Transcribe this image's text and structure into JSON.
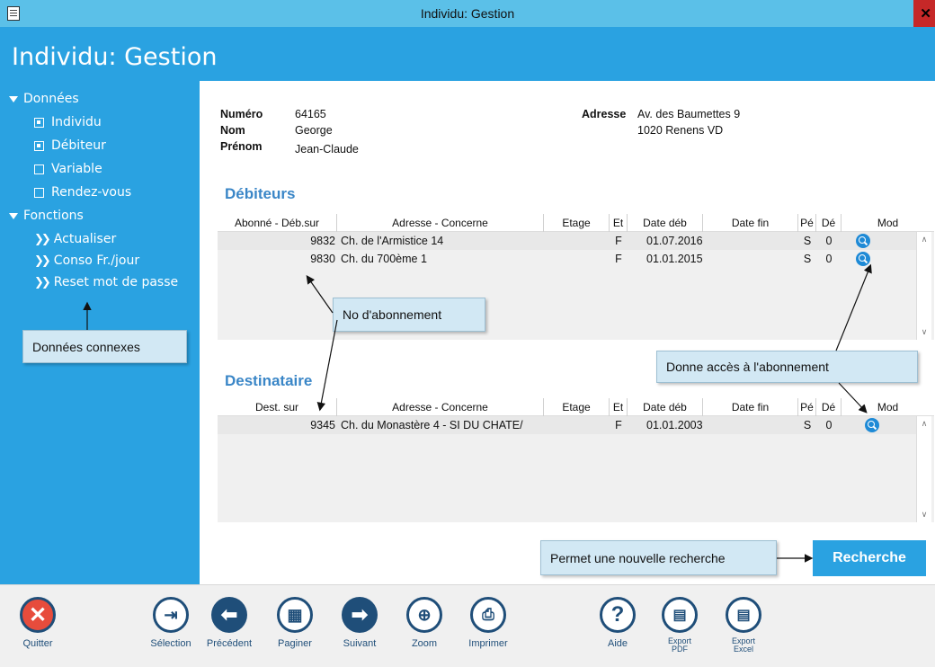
{
  "window": {
    "title": "Individu: Gestion"
  },
  "header": {
    "title": "Individu: Gestion"
  },
  "sidebar": {
    "groups": [
      {
        "label": "Données",
        "items": [
          "Individu",
          "Débiteur",
          "Variable",
          "Rendez-vous"
        ]
      },
      {
        "label": "Fonctions",
        "items": [
          "Actualiser",
          "Conso Fr./jour",
          "Reset mot de passe"
        ]
      }
    ]
  },
  "person": {
    "numero_label": "Numéro",
    "numero": "64165",
    "nom_label": "Nom",
    "nom": "George",
    "prenom_label": "Prénom",
    "prenom": "Jean-Claude",
    "adresse_label": "Adresse",
    "adresse_line1": "Av. des Baumettes 9",
    "adresse_line2": "1020 Renens VD"
  },
  "debiteurs": {
    "title": "Débiteurs",
    "columns": [
      "Abonné - Déb.sur",
      "Adresse - Concerne",
      "Etage",
      "Et",
      "Date déb",
      "Date fin",
      "Pé",
      "Dé",
      "Mod"
    ],
    "rows": [
      {
        "num": "9832",
        "adresse": "Ch. de l'Armistice 14",
        "etage": "",
        "et": "F",
        "date_deb": "01.07.2016",
        "date_fin": "",
        "pe": "S",
        "de": "0"
      },
      {
        "num": "9830",
        "adresse": "Ch. du 700ème 1",
        "etage": "",
        "et": "F",
        "date_deb": "01.01.2015",
        "date_fin": "",
        "pe": "S",
        "de": "0"
      }
    ]
  },
  "destinataire": {
    "title": "Destinataire",
    "columns": [
      "Dest. sur",
      "Adresse - Concerne",
      "Etage",
      "Et",
      "Date déb",
      "Date fin",
      "Pé",
      "Dé",
      "Mod"
    ],
    "rows": [
      {
        "num": "9345",
        "adresse": "Ch. du Monastère 4 - SI DU CHATE/",
        "etage": "",
        "et": "F",
        "date_deb": "01.01.2003",
        "date_fin": "",
        "pe": "S",
        "de": "0"
      }
    ]
  },
  "callouts": {
    "donnees_connexes": "Données connexes",
    "no_abonnement": "No d'abonnement",
    "acces_abonnement": "Donne accès à l'abonnement",
    "nouvelle_recherche": "Permet une nouvelle recherche"
  },
  "search_button": "Recherche",
  "toolbar": {
    "quitter": "Quitter",
    "selection": "Sélection",
    "precedent": "Précédent",
    "paginer": "Paginer",
    "suivant": "Suivant",
    "zoom": "Zoom",
    "imprimer": "Imprimer",
    "aide": "Aide",
    "export_pdf_1": "Export",
    "export_pdf_2": "PDF",
    "export_excel_1": "Export",
    "export_excel_2": "Excel"
  },
  "colors": {
    "accent": "#2aa2e1",
    "titlebar": "#5bc0e8",
    "icon": "#1f4e79",
    "section": "#3a86c7",
    "quit": "#e74c3c"
  }
}
